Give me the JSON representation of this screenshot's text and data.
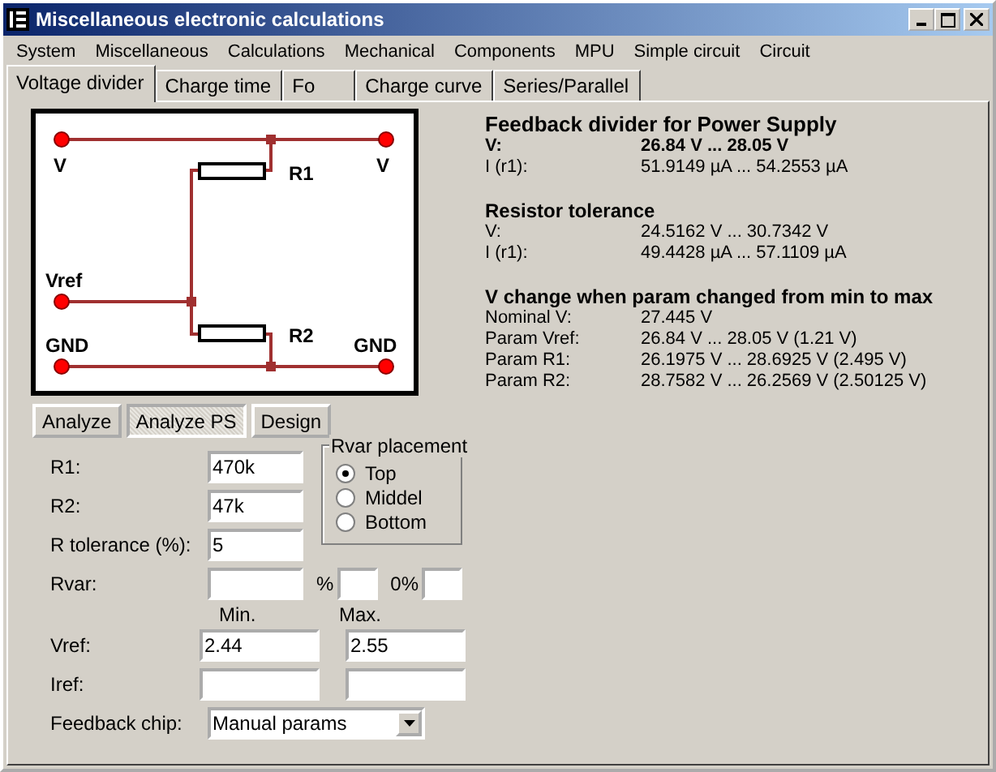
{
  "window": {
    "title": "Miscellaneous electronic calculations"
  },
  "menu": [
    "System",
    "Miscellaneous",
    "Calculations",
    "Mechanical",
    "Components",
    "MPU",
    "Simple circuit",
    "Circuit"
  ],
  "tabs": [
    {
      "label": "Voltage divider",
      "selected": true
    },
    {
      "label": "Charge time",
      "selected": false
    },
    {
      "label": "Fo",
      "selected": false
    },
    {
      "label": "Charge curve",
      "selected": false
    },
    {
      "label": "Series/Parallel",
      "selected": false
    }
  ],
  "circuit": {
    "top_left": "V",
    "top_right": "V",
    "r1": "R1",
    "middle": "Vref",
    "r2": "R2",
    "bottom_left": "GND",
    "bottom_right": "GND"
  },
  "buttons": [
    {
      "label": "Analyze",
      "selected": false
    },
    {
      "label": "Analyze PS",
      "selected": true
    },
    {
      "label": "Design",
      "selected": false
    }
  ],
  "fields": [
    {
      "label": "R1:",
      "value": "470k"
    },
    {
      "label": "R2:",
      "value": "47k"
    },
    {
      "label": "R tolerance (%):",
      "value": "5"
    }
  ],
  "rvar": {
    "label": "Rvar:",
    "percent_label": "%",
    "zero_label": "0%"
  },
  "rvar_placement": {
    "title": "Rvar placement",
    "options": [
      {
        "label": "Top",
        "selected": true
      },
      {
        "label": "Middel",
        "selected": false
      },
      {
        "label": "Bottom",
        "selected": false
      }
    ]
  },
  "range_headers": {
    "min": "Min.",
    "max": "Max."
  },
  "range_fields": [
    {
      "label": "Vref:",
      "min": "2.44",
      "max": "2.55"
    },
    {
      "label": "Iref:"
    }
  ],
  "feedback_chip": {
    "label": "Feedback chip:",
    "value": "Manual params"
  },
  "results": [
    {
      "heading": "Feedback divider for Power Supply",
      "large": true,
      "rows": [
        {
          "label": "V:",
          "value": "26.84 V ... 28.05 V",
          "bold": true
        },
        {
          "label": "I (r1):",
          "value": "51.9149 µA ... 54.2553 µA",
          "bold": false
        }
      ]
    },
    {
      "heading": "Resistor tolerance",
      "large": false,
      "rows": [
        {
          "label": "V:",
          "value": "24.5162 V ... 30.7342 V",
          "bold": false
        },
        {
          "label": "I (r1):",
          "value": "49.4428 µA ... 57.1109 µA",
          "bold": false
        }
      ]
    },
    {
      "heading": "V change when param changed from min to max",
      "large": false,
      "rows": [
        {
          "label": "Nominal V:",
          "value": "27.445 V",
          "bold": false
        },
        {
          "label": "Param Vref:",
          "value": "26.84 V ... 28.05 V (1.21 V)",
          "bold": false
        },
        {
          "label": "Param R1:",
          "value": "26.1975 V ... 28.6925 V (2.495 V)",
          "bold": false
        },
        {
          "label": "Param R2:",
          "value": "28.7582 V ... 26.2569 V (2.50125 V)",
          "bold": false
        }
      ]
    }
  ]
}
